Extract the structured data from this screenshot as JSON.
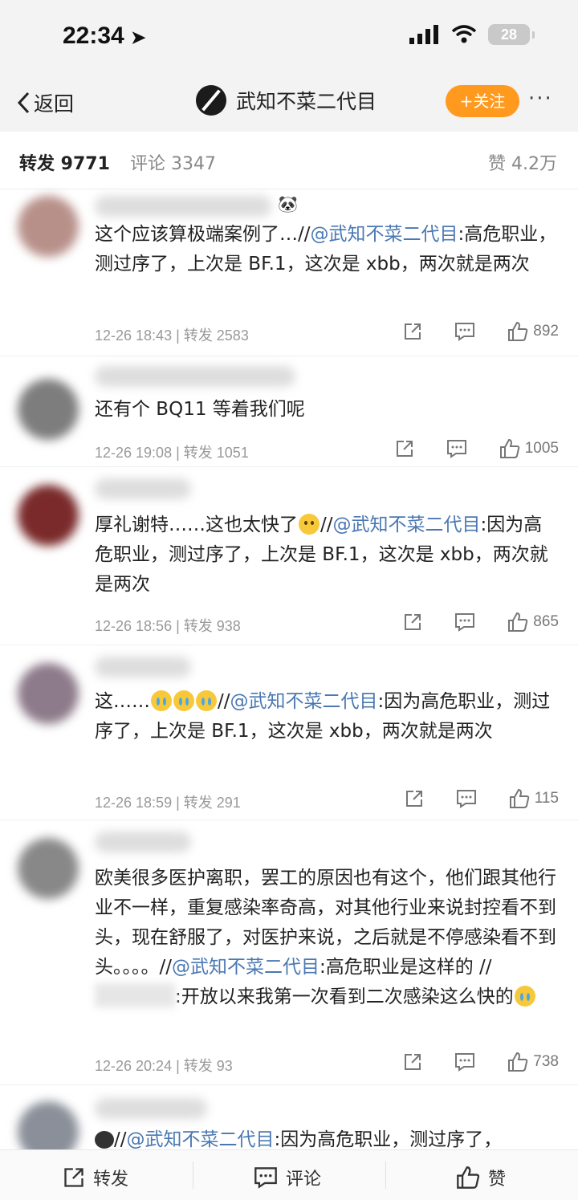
{
  "status": {
    "time": "22:34",
    "battery": "28"
  },
  "nav": {
    "back": "返回",
    "title": "武知不菜二代目",
    "follow": "+关注",
    "more": "···"
  },
  "tabs": {
    "repost": "转发 9771",
    "comment": "评论 3347",
    "like": "赞 4.2万"
  },
  "items": [
    {
      "pre": "这个应该算极端案例了…//",
      "mention": "@武知不菜二代目",
      "post": ":高危职业，测过序了，上次是 BF.1，这次是 xbb，两次就是两次",
      "time": "12-26 18:43",
      "repost": "转发 2583",
      "likes": "892"
    },
    {
      "pre": "还有个 BQ11 等着我们呢",
      "time": "12-26 19:08",
      "repost": "转发 1051",
      "likes": "1005"
    },
    {
      "pre": "厚礼谢特……这也太快了",
      "mid": "//",
      "mention": "@武知不菜二代目",
      "post": ":因为高危职业，测过序了，上次是 BF.1，这次是 xbb，两次就是两次",
      "time": "12-26 18:56",
      "repost": "转发 938",
      "likes": "865"
    },
    {
      "pre": "这……",
      "mid": "//",
      "mention": "@武知不菜二代目",
      "post": ":因为高危职业，测过序了，上次是 BF.1，这次是 xbb，两次就是两次",
      "time": "12-26 18:59",
      "repost": "转发 291",
      "likes": "115"
    },
    {
      "pre": "欧美很多医护离职，罢工的原因也有这个，他们跟其他行业不一样，重复感染率奇高，对其他行业来说封控看不到头，现在舒服了，对医护来说，之后就是不停感染看不到头。。。。//",
      "mention": "@武知不菜二代目",
      "post": ":高危职业是这样的 //",
      "post2": ":开放以来我第一次看到二次感染这么快的",
      "time": "12-26 20:24",
      "repost": "转发 93",
      "likes": "738"
    },
    {
      "pre": "//",
      "mention": "@武知不菜二代目",
      "post": ":因为高危职业，测过序了，"
    }
  ],
  "bottom": {
    "repost": "转发",
    "comment": "评论",
    "like": "赞"
  }
}
